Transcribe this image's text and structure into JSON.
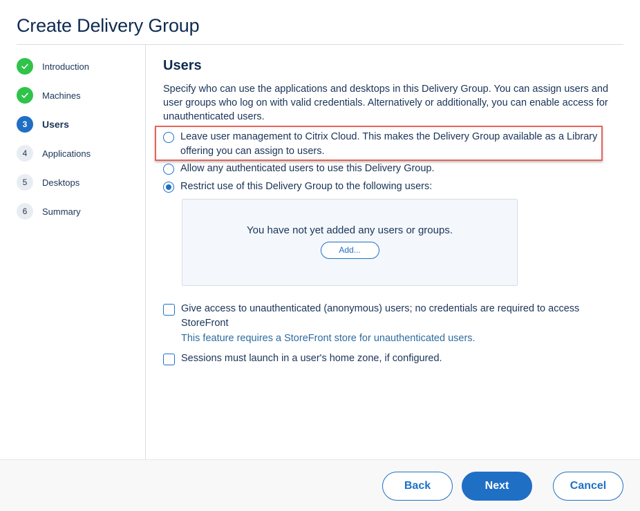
{
  "header": {
    "title": "Create Delivery Group"
  },
  "steps": [
    {
      "number": "1",
      "label": "Introduction",
      "status": "done",
      "icon": "check-icon"
    },
    {
      "number": "2",
      "label": "Machines",
      "status": "done",
      "icon": "check-icon"
    },
    {
      "number": "3",
      "label": "Users",
      "status": "current"
    },
    {
      "number": "4",
      "label": "Applications",
      "status": "todo"
    },
    {
      "number": "5",
      "label": "Desktops",
      "status": "todo"
    },
    {
      "number": "6",
      "label": "Summary",
      "status": "todo"
    }
  ],
  "main": {
    "title": "Users",
    "description": "Specify who can use the applications and desktops in this Delivery Group. You can assign users and user groups who log on with valid credentials. Alternatively or additionally, you can enable access for unauthenticated users.",
    "radio_options": [
      {
        "label": "Leave user management to Citrix Cloud. This makes the Delivery Group available as a Library offering you can assign to users.",
        "selected": false,
        "highlighted": true
      },
      {
        "label": "Allow any authenticated users to use this Delivery Group.",
        "selected": false
      },
      {
        "label": "Restrict use of this Delivery Group to the following users:",
        "selected": true
      }
    ],
    "users_box": {
      "empty_text": "You have not yet added any users or groups.",
      "add_label": "Add..."
    },
    "checkboxes": [
      {
        "label": "Give access to unauthenticated (anonymous) users; no credentials are required to access StoreFront",
        "checked": false,
        "note": "This feature requires a StoreFront store for unauthenticated users."
      },
      {
        "label": "Sessions must launch in a user's home zone, if configured.",
        "checked": false
      }
    ]
  },
  "footer": {
    "back_label": "Back",
    "next_label": "Next",
    "cancel_label": "Cancel"
  },
  "colors": {
    "accent": "#1f6fc5",
    "done": "#2fc34a",
    "highlight": "#e8635a",
    "title": "#0f2b52"
  }
}
